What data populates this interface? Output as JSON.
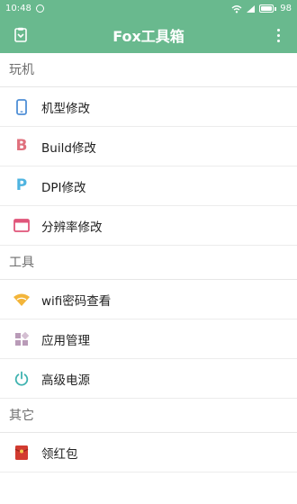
{
  "status_bar": {
    "time": "10:48",
    "battery": "98",
    "battery_level": 0.98
  },
  "app_bar": {
    "title": "Fox工具箱",
    "left_icon": "toolbox-icon",
    "menu_icon": "more-vert-icon"
  },
  "sections": [
    {
      "title": "玩机",
      "items": [
        {
          "label": "机型修改",
          "icon": "phone-icon",
          "color": "#4f8fd6"
        },
        {
          "label": "Build修改",
          "icon": "letter-b-icon",
          "icon_text": "B",
          "color": "#e0707d"
        },
        {
          "label": "DPI修改",
          "icon": "letter-p-icon",
          "icon_text": "P",
          "color": "#4fb4e0"
        },
        {
          "label": "分辨率修改",
          "icon": "window-icon",
          "color": "#e0557a"
        }
      ]
    },
    {
      "title": "工具",
      "items": [
        {
          "label": "wifi密码查看",
          "icon": "wifi-icon",
          "color": "#f3b53a"
        },
        {
          "label": "应用管理",
          "icon": "apps-icon",
          "color": "#b99bb8"
        },
        {
          "label": "高级电源",
          "icon": "power-icon",
          "color": "#3fb3b0"
        }
      ]
    },
    {
      "title": "其它",
      "items": [
        {
          "label": "领红包",
          "icon": "red-envelope-icon",
          "color": "#d23b30"
        }
      ]
    }
  ]
}
